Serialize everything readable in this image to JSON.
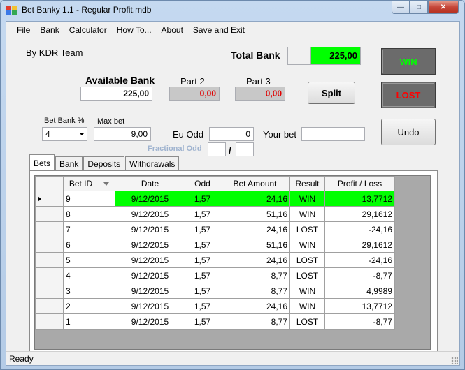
{
  "window": {
    "title": "Bet Banky 1.1 - Regular Profit.mdb",
    "minimize_glyph": "—",
    "maximize_glyph": "□",
    "close_glyph": "✕"
  },
  "menu": [
    "File",
    "Bank",
    "Calculator",
    "How To...",
    "About",
    "Save and Exit"
  ],
  "credits": "By KDR Team",
  "total_bank": {
    "label": "Total Bank",
    "value": "225,00",
    "color": "#00ff00"
  },
  "available_bank": {
    "label": "Available Bank",
    "value": "225,00"
  },
  "part2": {
    "label": "Part 2",
    "value": "0,00"
  },
  "part3": {
    "label": "Part 3",
    "value": "0,00"
  },
  "buttons": {
    "split": "Split",
    "win": "WIN",
    "lost": "LOST",
    "undo": "Undo",
    "win_color": "#00ff00",
    "lost_color": "#ff0000"
  },
  "bet_bank_pct": {
    "label": "Bet Bank %",
    "value": "4"
  },
  "max_bet": {
    "label": "Max bet",
    "value": "9,00"
  },
  "eu_odd": {
    "label": "Eu Odd",
    "value": "0"
  },
  "your_bet": {
    "label": "Your bet",
    "value": ""
  },
  "fractional_odd": {
    "label": "Fractional Odd",
    "separator": "/",
    "numerator": "",
    "denominator": ""
  },
  "tabs": [
    "Bets",
    "Bank",
    "Deposits",
    "Withdrawals"
  ],
  "grid": {
    "columns": [
      "Bet ID",
      "Date",
      "Odd",
      "Bet Amount",
      "Result",
      "Profit / Loss"
    ],
    "highlight_color": "#00ff00",
    "rows": [
      {
        "id": "9",
        "date": "9/12/2015",
        "odd": "1,57",
        "amount": "24,16",
        "result": "WIN",
        "pl": "13,7712"
      },
      {
        "id": "8",
        "date": "9/12/2015",
        "odd": "1,57",
        "amount": "51,16",
        "result": "WIN",
        "pl": "29,1612"
      },
      {
        "id": "7",
        "date": "9/12/2015",
        "odd": "1,57",
        "amount": "24,16",
        "result": "LOST",
        "pl": "-24,16"
      },
      {
        "id": "6",
        "date": "9/12/2015",
        "odd": "1,57",
        "amount": "51,16",
        "result": "WIN",
        "pl": "29,1612"
      },
      {
        "id": "5",
        "date": "9/12/2015",
        "odd": "1,57",
        "amount": "24,16",
        "result": "LOST",
        "pl": "-24,16"
      },
      {
        "id": "4",
        "date": "9/12/2015",
        "odd": "1,57",
        "amount": "8,77",
        "result": "LOST",
        "pl": "-8,77"
      },
      {
        "id": "3",
        "date": "9/12/2015",
        "odd": "1,57",
        "amount": "8,77",
        "result": "WIN",
        "pl": "4,9989"
      },
      {
        "id": "2",
        "date": "9/12/2015",
        "odd": "1,57",
        "amount": "24,16",
        "result": "WIN",
        "pl": "13,7712"
      },
      {
        "id": "1",
        "date": "9/12/2015",
        "odd": "1,57",
        "amount": "8,77",
        "result": "LOST",
        "pl": "-8,77"
      }
    ]
  },
  "status": "Ready"
}
